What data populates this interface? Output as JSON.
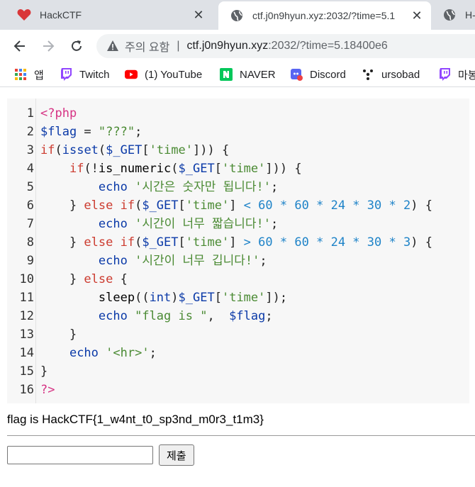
{
  "tabs": [
    {
      "label": "HackCTF",
      "icon": "heart-icon",
      "active": false
    },
    {
      "label": "ctf.j0n9hyun.xyz:2032/?time=5.1",
      "icon": "globe-icon",
      "active": true
    },
    {
      "label": "H-",
      "icon": "globe-icon",
      "active": false
    }
  ],
  "toolbar": {
    "security_label": "주의 요함",
    "url_host": "ctf.j0n9hyun.xyz",
    "url_path": ":2032/?time=5.18400e6"
  },
  "bookmarks": [
    {
      "label": "앱",
      "icon": "apps-grid-icon"
    },
    {
      "label": "Twitch",
      "icon": "twitch-icon"
    },
    {
      "label": "(1) YouTube",
      "icon": "youtube-icon"
    },
    {
      "label": "NAVER",
      "icon": "naver-icon"
    },
    {
      "label": "Discord",
      "icon": "discord-icon"
    },
    {
      "label": "ursobad",
      "icon": "ursobad-icon"
    },
    {
      "label": "마봉",
      "icon": "twitch-icon"
    }
  ],
  "code": {
    "line_numbers": [
      "1",
      "2",
      "3",
      "4",
      "5",
      "6",
      "7",
      "8",
      "9",
      "10",
      "11",
      "12",
      "13",
      "14",
      "15",
      "16"
    ],
    "lines": [
      [
        {
          "t": "<?php",
          "c": "tag"
        }
      ],
      [
        {
          "t": "$flag",
          "c": "var"
        },
        {
          "t": " = ",
          "c": "p"
        },
        {
          "t": "\"???\"",
          "c": "str"
        },
        {
          "t": ";",
          "c": "p"
        }
      ],
      [
        {
          "t": "if",
          "c": "kw2"
        },
        {
          "t": "(",
          "c": "p"
        },
        {
          "t": "isset",
          "c": "kw"
        },
        {
          "t": "(",
          "c": "p"
        },
        {
          "t": "$_GET",
          "c": "var"
        },
        {
          "t": "[",
          "c": "p"
        },
        {
          "t": "'time'",
          "c": "str"
        },
        {
          "t": "])) {",
          "c": "p"
        }
      ],
      [
        {
          "t": "    ",
          "c": "p"
        },
        {
          "t": "if",
          "c": "kw2"
        },
        {
          "t": "(!",
          "c": "p"
        },
        {
          "t": "is_numeric",
          "c": "fn"
        },
        {
          "t": "(",
          "c": "p"
        },
        {
          "t": "$_GET",
          "c": "var"
        },
        {
          "t": "[",
          "c": "p"
        },
        {
          "t": "'time'",
          "c": "str"
        },
        {
          "t": "])) {",
          "c": "p"
        }
      ],
      [
        {
          "t": "        ",
          "c": "p"
        },
        {
          "t": "echo",
          "c": "kw"
        },
        {
          "t": " ",
          "c": "p"
        },
        {
          "t": "'시간은 숫자만 됩니다!'",
          "c": "str"
        },
        {
          "t": ";",
          "c": "p"
        }
      ],
      [
        {
          "t": "    } ",
          "c": "p"
        },
        {
          "t": "else if",
          "c": "kw2"
        },
        {
          "t": "(",
          "c": "p"
        },
        {
          "t": "$_GET",
          "c": "var"
        },
        {
          "t": "[",
          "c": "p"
        },
        {
          "t": "'time'",
          "c": "str"
        },
        {
          "t": "] ",
          "c": "p"
        },
        {
          "t": "<",
          "c": "op"
        },
        {
          "t": " ",
          "c": "p"
        },
        {
          "t": "60",
          "c": "num"
        },
        {
          "t": " * ",
          "c": "op"
        },
        {
          "t": "60",
          "c": "num"
        },
        {
          "t": " * ",
          "c": "op"
        },
        {
          "t": "24",
          "c": "num"
        },
        {
          "t": " * ",
          "c": "op"
        },
        {
          "t": "30",
          "c": "num"
        },
        {
          "t": " * ",
          "c": "op"
        },
        {
          "t": "2",
          "c": "num"
        },
        {
          "t": ") {",
          "c": "p"
        }
      ],
      [
        {
          "t": "        ",
          "c": "p"
        },
        {
          "t": "echo",
          "c": "kw"
        },
        {
          "t": " ",
          "c": "p"
        },
        {
          "t": "'시간이 너무 짧습니다!'",
          "c": "str"
        },
        {
          "t": ";",
          "c": "p"
        }
      ],
      [
        {
          "t": "    } ",
          "c": "p"
        },
        {
          "t": "else if",
          "c": "kw2"
        },
        {
          "t": "(",
          "c": "p"
        },
        {
          "t": "$_GET",
          "c": "var"
        },
        {
          "t": "[",
          "c": "p"
        },
        {
          "t": "'time'",
          "c": "str"
        },
        {
          "t": "] ",
          "c": "p"
        },
        {
          "t": ">",
          "c": "op"
        },
        {
          "t": " ",
          "c": "p"
        },
        {
          "t": "60",
          "c": "num"
        },
        {
          "t": " * ",
          "c": "op"
        },
        {
          "t": "60",
          "c": "num"
        },
        {
          "t": " * ",
          "c": "op"
        },
        {
          "t": "24",
          "c": "num"
        },
        {
          "t": " * ",
          "c": "op"
        },
        {
          "t": "30",
          "c": "num"
        },
        {
          "t": " * ",
          "c": "op"
        },
        {
          "t": "3",
          "c": "num"
        },
        {
          "t": ") {",
          "c": "p"
        }
      ],
      [
        {
          "t": "        ",
          "c": "p"
        },
        {
          "t": "echo",
          "c": "kw"
        },
        {
          "t": " ",
          "c": "p"
        },
        {
          "t": "'시간이 너무 깁니다!'",
          "c": "str"
        },
        {
          "t": ";",
          "c": "p"
        }
      ],
      [
        {
          "t": "    } ",
          "c": "p"
        },
        {
          "t": "else",
          "c": "kw2"
        },
        {
          "t": " {",
          "c": "p"
        }
      ],
      [
        {
          "t": "        ",
          "c": "p"
        },
        {
          "t": "sleep",
          "c": "fn"
        },
        {
          "t": "((",
          "c": "p"
        },
        {
          "t": "int",
          "c": "kw"
        },
        {
          "t": ")",
          "c": "p"
        },
        {
          "t": "$_GET",
          "c": "var"
        },
        {
          "t": "[",
          "c": "p"
        },
        {
          "t": "'time'",
          "c": "str"
        },
        {
          "t": "]);",
          "c": "p"
        }
      ],
      [
        {
          "t": "        ",
          "c": "p"
        },
        {
          "t": "echo",
          "c": "kw"
        },
        {
          "t": " ",
          "c": "p"
        },
        {
          "t": "\"flag is \"",
          "c": "str"
        },
        {
          "t": ",  ",
          "c": "p"
        },
        {
          "t": "$flag",
          "c": "var"
        },
        {
          "t": ";",
          "c": "p"
        }
      ],
      [
        {
          "t": "    }",
          "c": "p"
        }
      ],
      [
        {
          "t": "    ",
          "c": "p"
        },
        {
          "t": "echo",
          "c": "kw"
        },
        {
          "t": " ",
          "c": "p"
        },
        {
          "t": "'<hr>'",
          "c": "str"
        },
        {
          "t": ";",
          "c": "p"
        }
      ],
      [
        {
          "t": "}",
          "c": "p"
        }
      ],
      [
        {
          "t": "?>",
          "c": "tag"
        }
      ]
    ]
  },
  "output": {
    "flag_text": "flag is HackCTF{1_w4nt_t0_sp3nd_m0r3_t1m3}"
  },
  "form": {
    "input_value": "",
    "submit_label": "제출"
  }
}
